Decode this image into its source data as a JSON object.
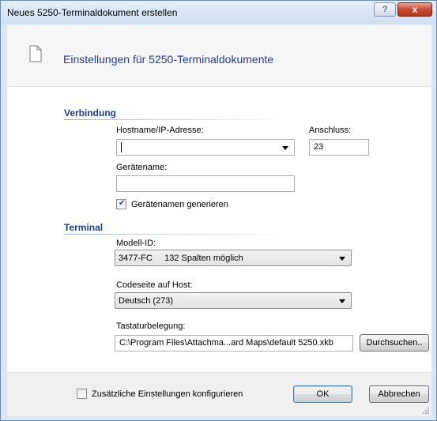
{
  "window": {
    "title": "Neues 5250-Terminaldokument erstellen",
    "help_glyph": "?",
    "close_glyph": "x"
  },
  "header": {
    "title": "Einstellungen für 5250-Terminaldokumente"
  },
  "connection": {
    "section_label": "Verbindung",
    "hostname_label": "Hostname/IP-Adresse:",
    "hostname_value": "",
    "port_label": "Anschluss:",
    "port_value": "23",
    "device_name_label": "Gerätename:",
    "device_name_value": "",
    "generate_device_names_label": "Gerätenamen generieren",
    "generate_device_names_checked": true
  },
  "terminal": {
    "section_label": "Terminal",
    "model_label": "Modell-ID:",
    "model_value": "3477-FC     132 Spalten möglich",
    "codepage_label": "Codeseite auf Host:",
    "codepage_value": "Deutsch (273)",
    "keyboard_label": "Tastaturbelegung:",
    "keyboard_value": "C:\\Program Files\\Attachma...ard Maps\\default 5250.xkb",
    "browse_label": "Durchsuchen.."
  },
  "footer": {
    "additional_settings_label": "Zusätzliche Einstellungen konfigurieren",
    "additional_settings_checked": false,
    "ok_label": "OK",
    "cancel_label": "Abbrechen"
  },
  "colors": {
    "section_heading": "#1e3f8f",
    "header_text": "#1e3f8f",
    "close_button": "#c74a32",
    "frame": "#d9e6f5"
  },
  "icons": {
    "header": "document-icon",
    "help": "help-icon",
    "close": "close-icon"
  }
}
